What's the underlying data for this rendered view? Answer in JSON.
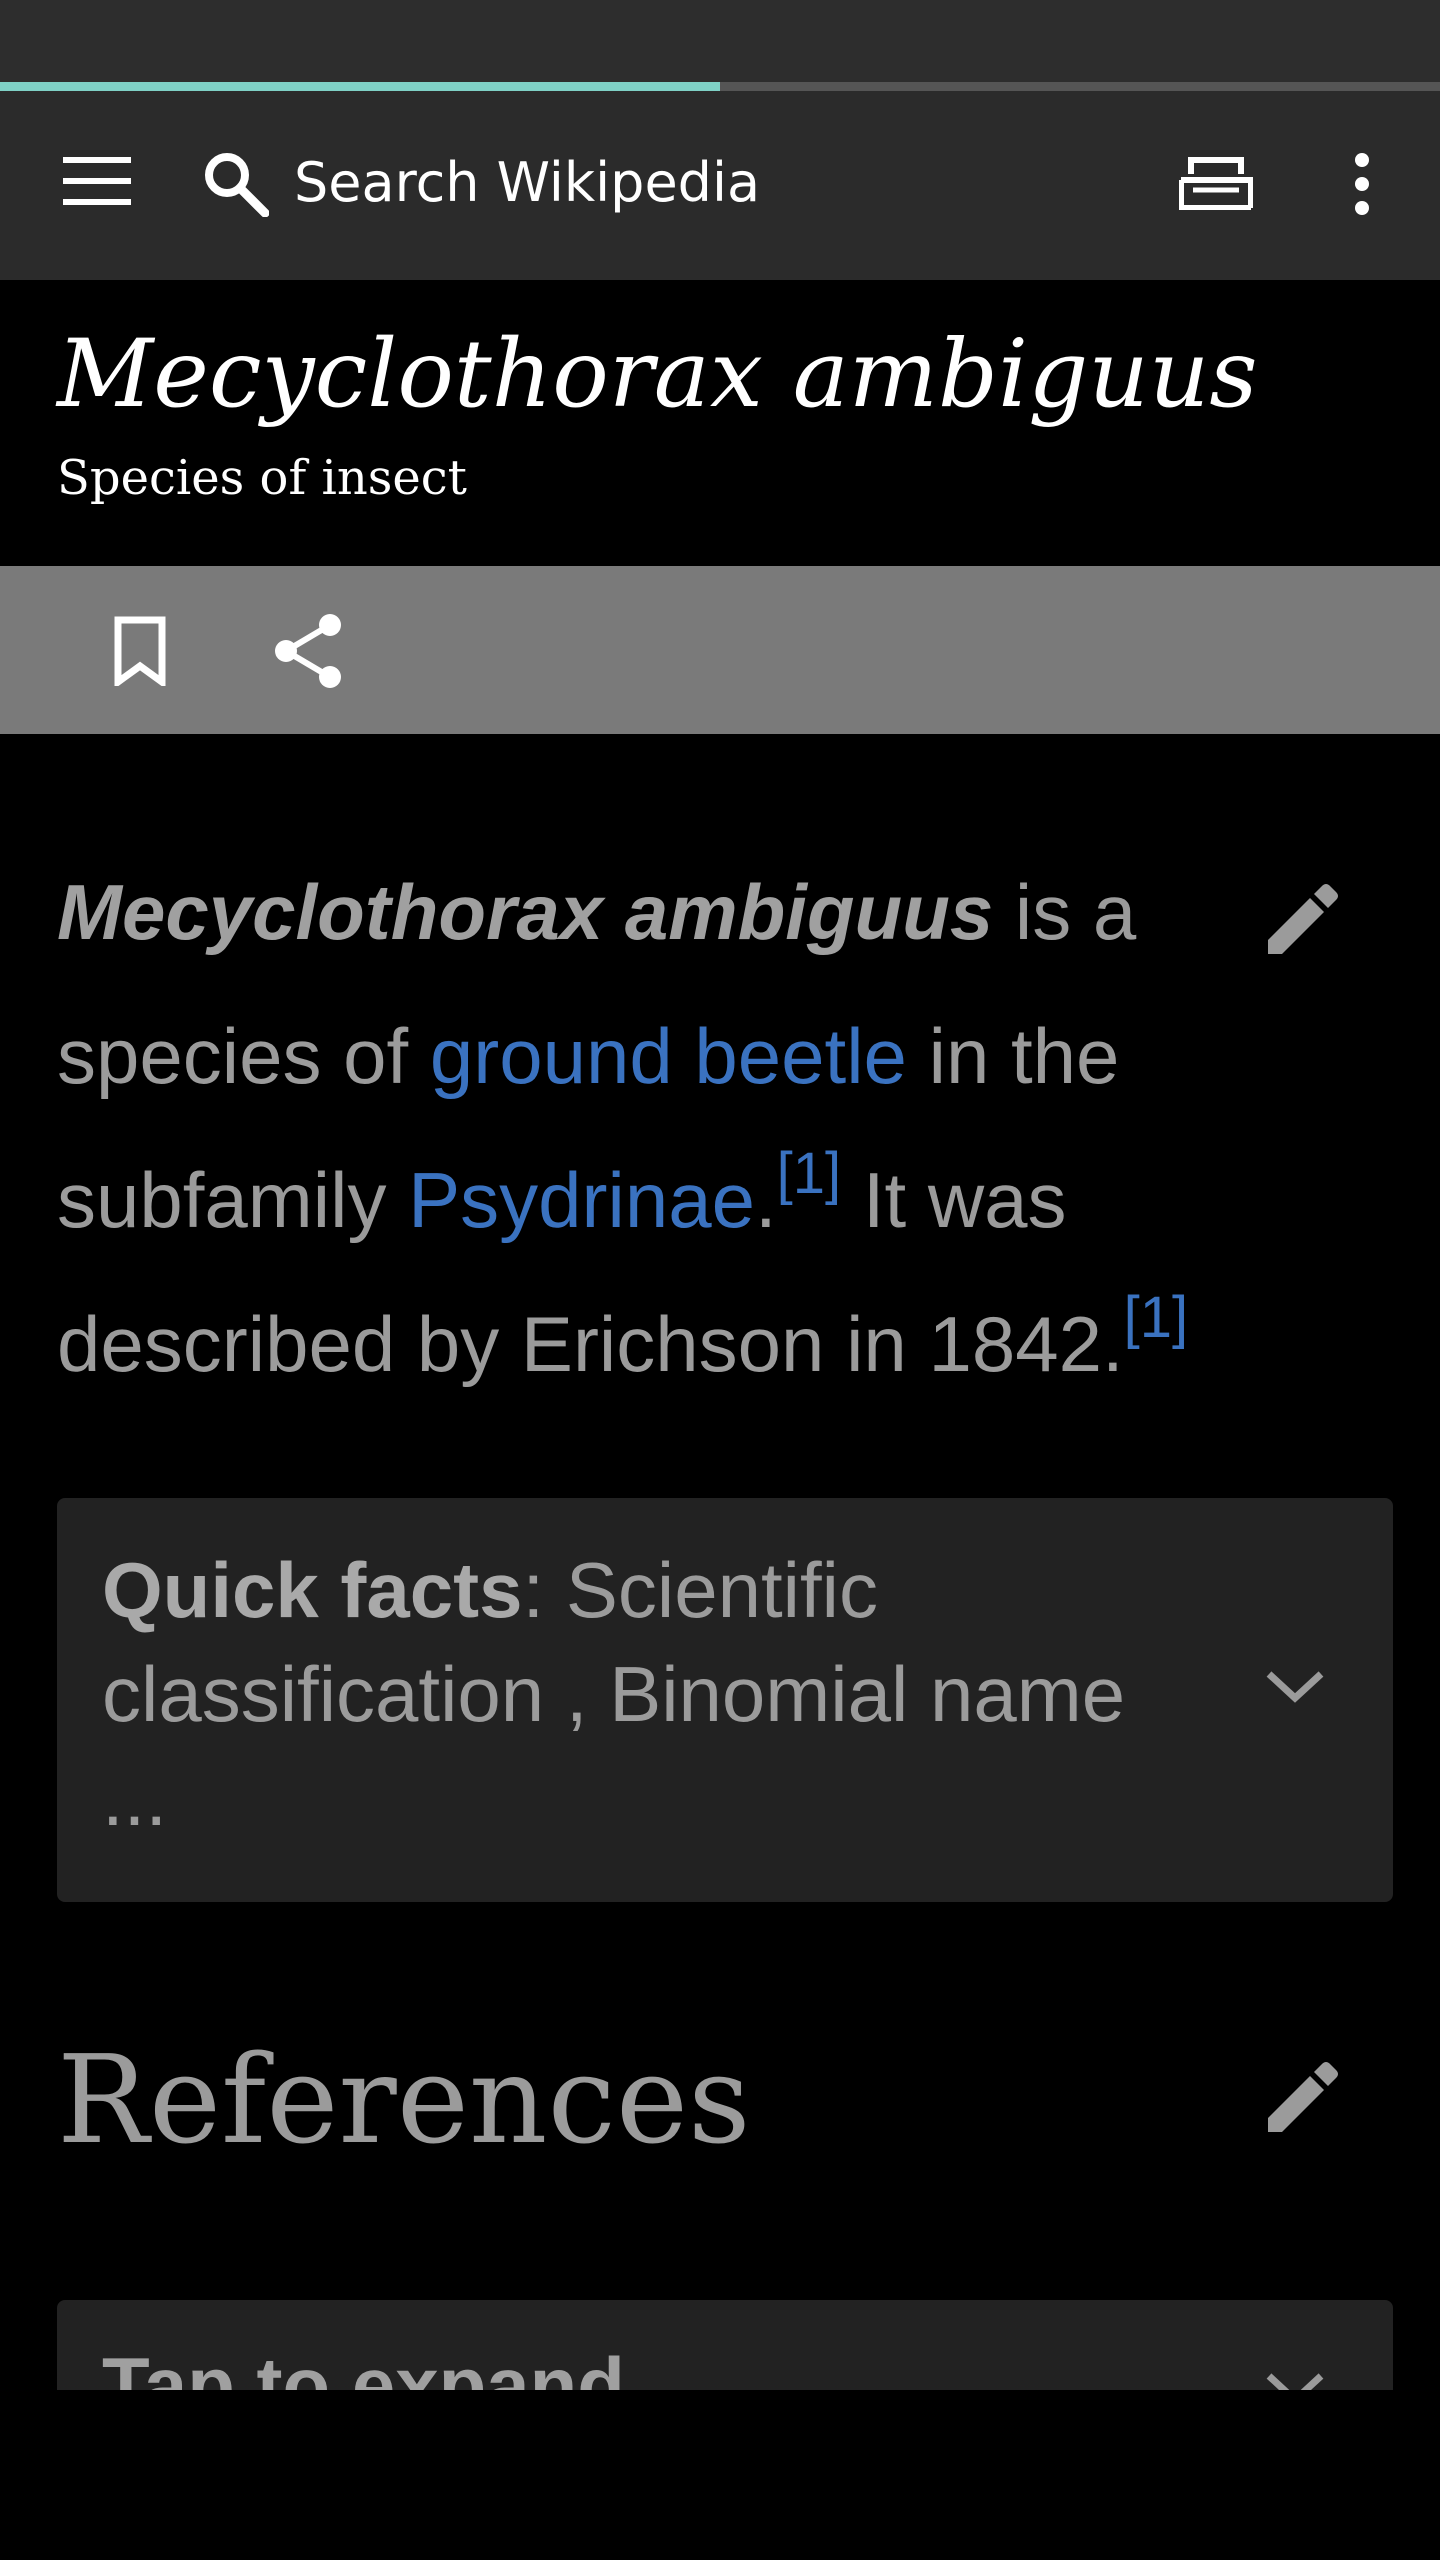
{
  "toolbar": {
    "search_placeholder": "Search Wikipedia"
  },
  "progress": {
    "fraction": 0.5
  },
  "article": {
    "title": "Mecyclothorax ambiguus",
    "subtitle": "Species of insect",
    "intro": {
      "bold_name": "Mecyclothorax ambiguus",
      "t1": " is a species of ",
      "link1": "ground beetle",
      "t2": " in the subfamily ",
      "link2": "Psydrinae",
      "t3": ".",
      "ref1": "[1]",
      "t4": " It was described by Erichson in 1842.",
      "ref2": "[1]"
    },
    "quick_facts": {
      "label": "Quick facts",
      "text": ": Scientific classification , Binomial name ..."
    },
    "references_heading": "References",
    "expand_label": "Tap to expand"
  },
  "icons": {
    "menu": "menu-icon",
    "search": "search-icon",
    "tabs": "tabs-icon",
    "overflow": "more-vert-icon",
    "bookmark": "bookmark-icon",
    "share": "share-icon",
    "edit": "pencil-icon",
    "expand": "chevron-down-icon"
  },
  "colors": {
    "accent": "#7fd1c6",
    "link": "#3a72c0",
    "toolbar": "#2b2b2b",
    "action_bar": "#7a7a7a",
    "card": "#222222"
  }
}
